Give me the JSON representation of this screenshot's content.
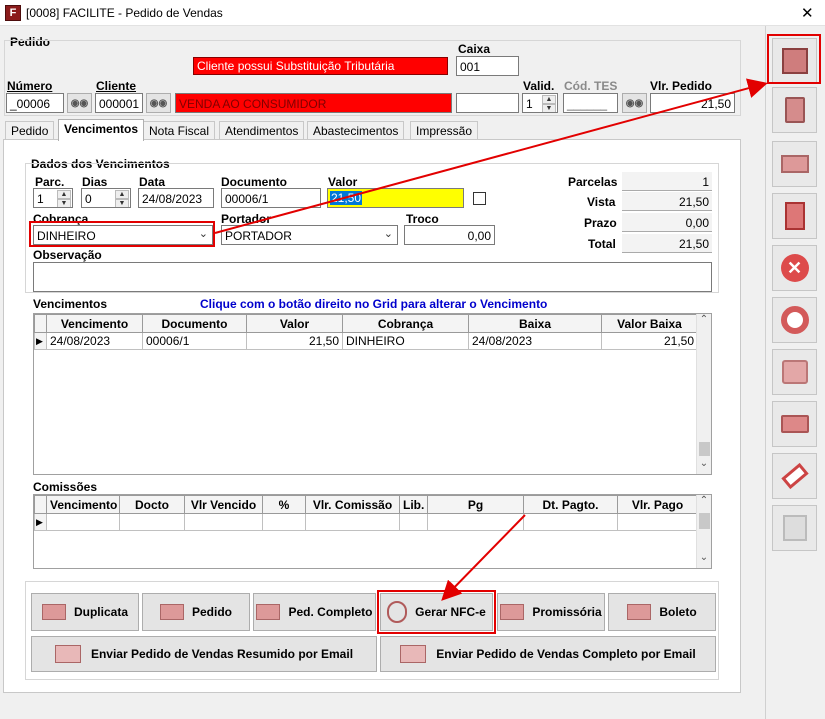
{
  "window": {
    "title": "[0008] FACILITE - Pedido de Vendas",
    "close_glyph": "✕",
    "logo_text": "F"
  },
  "pedido_group": {
    "label": "Pedido"
  },
  "alert": "Cliente possui Substituição Tributária",
  "caixa": {
    "label": "Caixa",
    "value": "001"
  },
  "numero": {
    "label": "Número",
    "value": "_00006"
  },
  "cliente": {
    "label": "Cliente",
    "code": "000001",
    "name": "VENDA AO CONSUMIDOR"
  },
  "valid": {
    "label": "Valid.",
    "value": "1"
  },
  "cod_tes": {
    "label": "Cód. TES",
    "value": "______"
  },
  "vlr_pedido": {
    "label": "Vlr. Pedido",
    "value": "21,50"
  },
  "tabs": [
    "Pedido",
    "Vencimentos",
    "Nota Fiscal",
    "Atendimentos",
    "Abastecimentos",
    "Impressão"
  ],
  "dados": {
    "group_label": "Dados dos Vencimentos",
    "parc": {
      "label": "Parc.",
      "value": "1"
    },
    "dias": {
      "label": "Dias",
      "value": "0"
    },
    "data": {
      "label": "Data",
      "value": "24/08/2023"
    },
    "documento": {
      "label": "Documento",
      "value": "00006/1"
    },
    "valor": {
      "label": "Valor",
      "value": "21,50"
    },
    "cobranca": {
      "label": "Cobrança",
      "value": "DINHEIRO"
    },
    "portador": {
      "label": "Portador",
      "value": "PORTADOR"
    },
    "troco": {
      "label": "Troco",
      "value": "0,00"
    },
    "observacao": {
      "label": "Observação",
      "value": ""
    }
  },
  "summary": {
    "parcelas": {
      "label": "Parcelas",
      "value": "1"
    },
    "vista": {
      "label": "Vista",
      "value": "21,50"
    },
    "prazo": {
      "label": "Prazo",
      "value": "0,00"
    },
    "total": {
      "label": "Total",
      "value": "21,50"
    }
  },
  "vencimentos": {
    "label": "Vencimentos",
    "hint": "Clique com o botão direito no Grid para alterar o Vencimento",
    "columns": [
      "Vencimento",
      "Documento",
      "Valor",
      "Cobrança",
      "Baixa",
      "Valor Baixa"
    ],
    "rows": [
      [
        "24/08/2023",
        "00006/1",
        "21,50",
        "DINHEIRO",
        "24/08/2023",
        "21,50"
      ]
    ]
  },
  "comissoes": {
    "label": "Comissões",
    "columns": [
      "Vencimento",
      "Docto",
      "Vlr Vencido",
      "%",
      "Vlr. Comissão",
      "Lib.",
      "Pg",
      "Dt. Pagto.",
      "Vlr. Pago"
    ]
  },
  "buttons": {
    "duplicata": "Duplicata",
    "pedido": "Pedido",
    "ped_completo": "Ped. Completo",
    "gerar_nfce": "Gerar NFC-e",
    "promissoria": "Promissória",
    "boleto": "Boleto",
    "email_resumido": "Enviar Pedido de Vendas Resumido por Email",
    "email_completo": "Enviar Pedido de Vendas Completo por Email"
  },
  "colors": {
    "alert_red": "#ff0000",
    "highlight_yellow": "#ffff00",
    "annotation_red": "#e20000",
    "hint_blue": "#0000cc"
  }
}
